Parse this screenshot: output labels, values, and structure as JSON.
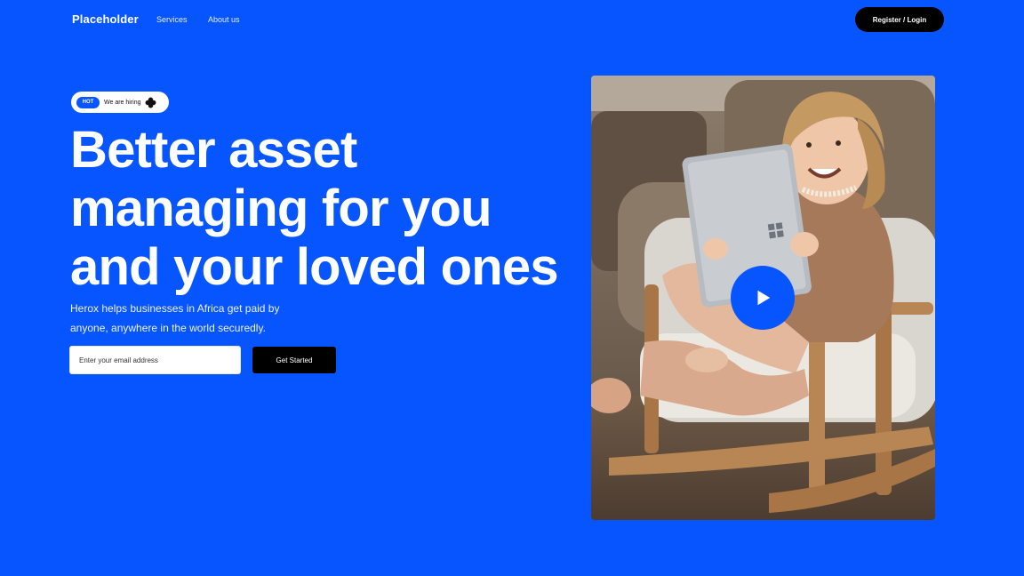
{
  "nav": {
    "logo": "Placeholder",
    "links": [
      "Services",
      "About us"
    ],
    "register_label": "Register / Login"
  },
  "badge": {
    "tag": "HOT",
    "text": "We are hiring",
    "icon": "flower-icon"
  },
  "hero": {
    "headline_lines": [
      "Better asset",
      "managing for you",
      "and your loved ones"
    ],
    "subtext_lines": [
      "Herox helps businesses in Africa get paid by",
      "anyone, anywhere in the world securedly."
    ],
    "email_placeholder": "Enter your email address",
    "cta_label": "Get Started"
  },
  "media": {
    "image_subject": "child with tablet in rocking chair",
    "play_icon": "play-icon"
  },
  "colors": {
    "background": "#0655fe",
    "accent": "#0655fe",
    "button_dark": "#000000"
  }
}
